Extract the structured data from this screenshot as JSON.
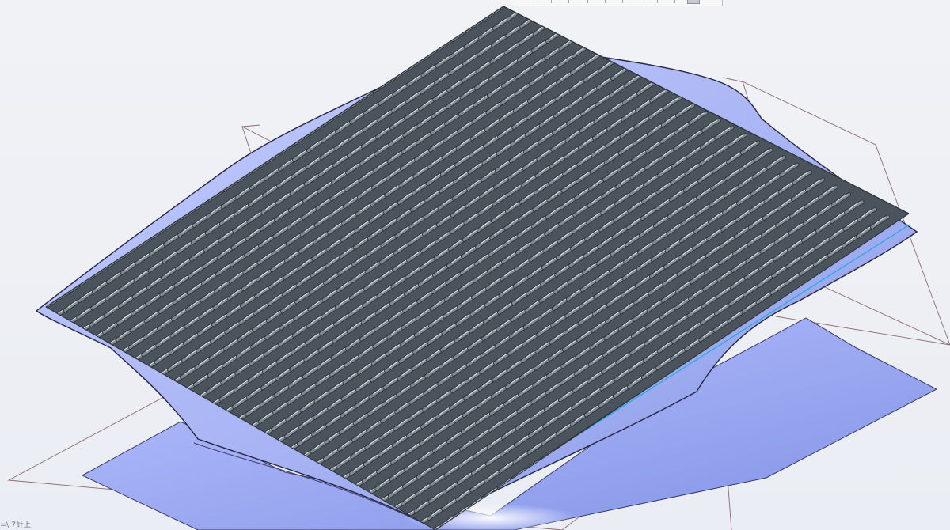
{
  "viewport": {
    "background": "#eef0f5",
    "corner_label": "=\\ 7計上"
  },
  "model": {
    "mesh_rows": 30,
    "mesh_cols": 32,
    "surface_fill": "#a8b4f4",
    "surface_stroke": "#3a3a62",
    "lower_plane_fill": "#9aa7f1",
    "datum_color": "#8c6a72",
    "highlight_edge": "#25a7e6",
    "wire_fill": "#7f8a93",
    "wire_highlight": "#dde3e8",
    "wire_shadow": "#2b3238"
  },
  "toolbar": {
    "icons": [
      "toolbar-item-1",
      "toolbar-item-2",
      "toolbar-item-3",
      "toolbar-item-4",
      "toolbar-item-5",
      "toolbar-item-6",
      "toolbar-item-7",
      "toolbar-item-8",
      "toolbar-item-9",
      "toolbar-dropdown"
    ]
  }
}
